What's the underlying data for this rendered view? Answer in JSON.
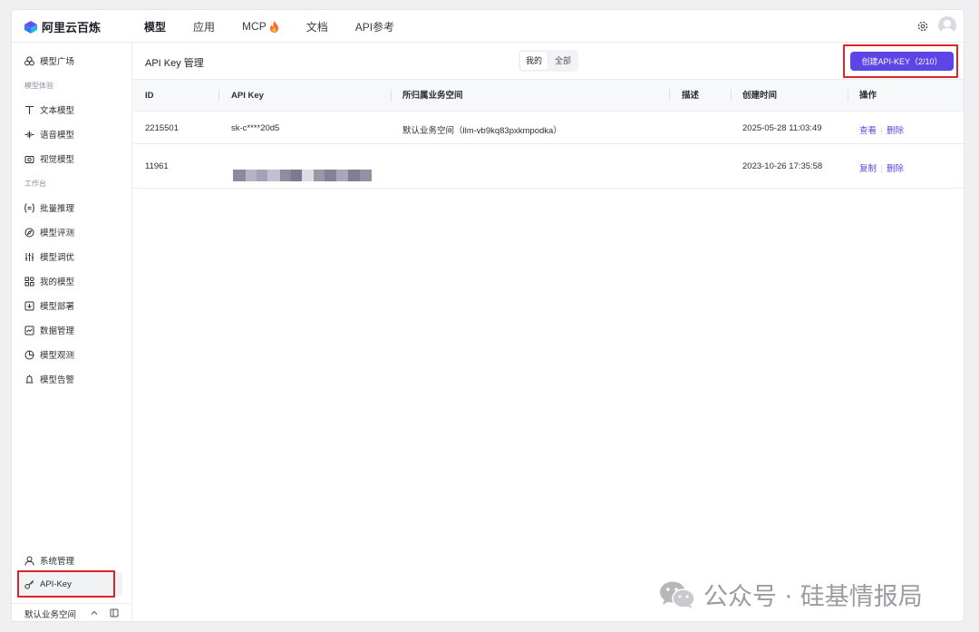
{
  "brand": {
    "name": "阿里云百炼"
  },
  "nav": {
    "tabs": [
      {
        "label": "模型",
        "active": true
      },
      {
        "label": "应用"
      },
      {
        "label": "MCP"
      },
      {
        "label": "文档"
      },
      {
        "label": "API参考"
      }
    ]
  },
  "sidebar": {
    "top_item": "模型广场",
    "group1": "模型体验",
    "exp_items": [
      "文本模型",
      "语音模型",
      "视觉模型"
    ],
    "group2": "工作台",
    "work_items": [
      "批量推理",
      "模型评测",
      "模型调优",
      "我的模型",
      "模型部署",
      "数据管理",
      "模型观测",
      "模型告警"
    ],
    "system": "系统管理",
    "apikey": "API-Key",
    "workspace": "默认业务空间"
  },
  "page": {
    "title": "API Key 管理",
    "segments": [
      "我的",
      "全部"
    ],
    "create_button": "创建API-KEY（2/10）"
  },
  "table": {
    "columns": [
      "ID",
      "API Key",
      "所归属业务空间",
      "描述",
      "创建时间",
      "操作"
    ],
    "rows": [
      {
        "id": "2215501",
        "key": "sk-c****20d5",
        "workspace": "默认业务空间（llm-vb9kq83pxkmpodka）",
        "desc": "",
        "created": "2025-05-28 11:03:49",
        "ops": [
          "查看",
          "删除"
        ]
      },
      {
        "id": "11961",
        "key": "",
        "workspace": "",
        "desc": "",
        "created": "2023-10-26 17:35:58",
        "ops": [
          "复制",
          "删除"
        ]
      }
    ]
  },
  "watermark": {
    "text": "公众号 · 硅基情报局"
  },
  "colors": {
    "accent": "#5c44e6",
    "highlight": "#d9242b"
  }
}
